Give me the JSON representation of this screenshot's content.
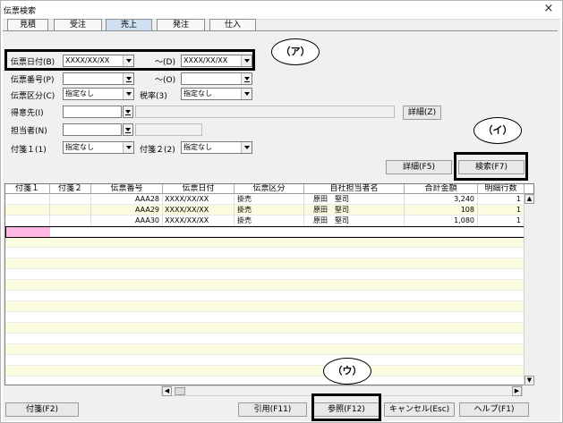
{
  "window": {
    "title": "伝票検索",
    "close_glyph": "×"
  },
  "tabs": [
    {
      "label": "見積",
      "active": false
    },
    {
      "label": "受注",
      "active": false
    },
    {
      "label": "売上",
      "active": true
    },
    {
      "label": "発注",
      "active": false
    },
    {
      "label": "仕入",
      "active": false
    }
  ],
  "form": {
    "date_label": "伝票日付(B)",
    "date_from": "XXXX/XX/XX",
    "date_tilde": "～(D)",
    "date_to": "XXXX/XX/XX",
    "number_label": "伝票番号(P)",
    "number_from": "",
    "number_tilde": "～(O)",
    "number_to": "",
    "kubun_label": "伝票区分(C)",
    "kubun_value": "指定なし",
    "tax_label": "税率(3)",
    "tax_value": "指定なし",
    "customer_label": "得意先(I)",
    "customer_value": "",
    "staff_label": "担当者(N)",
    "staff_value": "",
    "tag1_label": "付箋１(1)",
    "tag1_value": "指定なし",
    "tag2_label": "付箋２(2)",
    "tag2_value": "指定なし",
    "detail_z_button": "詳細(Z)",
    "detail_f5_button": "詳細(F5)",
    "search_button": "検索(F7)"
  },
  "callouts": {
    "a": "（ア）",
    "i": "（イ）",
    "u": "（ウ）"
  },
  "grid": {
    "columns": [
      "付箋１",
      "付箋２",
      "伝票番号",
      "伝票日付",
      "伝票区分",
      "自社担当者名",
      "合計金額",
      "明細行数"
    ],
    "rows": [
      {
        "tag1": "",
        "tag2": "",
        "number": "AAA28",
        "date": "XXXX/XX/XX",
        "kubun": "掛売",
        "staff": "原田　堅司",
        "total": "3,240",
        "lines": "1"
      },
      {
        "tag1": "",
        "tag2": "",
        "number": "AAA29",
        "date": "XXXX/XX/XX",
        "kubun": "掛売",
        "staff": "原田　堅司",
        "total": "108",
        "lines": "1"
      },
      {
        "tag1": "",
        "tag2": "",
        "number": "AAA30",
        "date": "XXXX/XX/XX",
        "kubun": "掛売",
        "staff": "原田　堅司",
        "total": "1,080",
        "lines": "1"
      }
    ],
    "tag_colors": {
      "pink": "#ffb7e3",
      "alt_row": "#fbfbdf"
    }
  },
  "footer": {
    "tag_button": "付箋(F2)",
    "cite_button": "引用(F11)",
    "ref_button": "参照(F12)",
    "cancel_button": "キャンセル(Esc)",
    "help_button": "ヘルプ(F1)"
  }
}
